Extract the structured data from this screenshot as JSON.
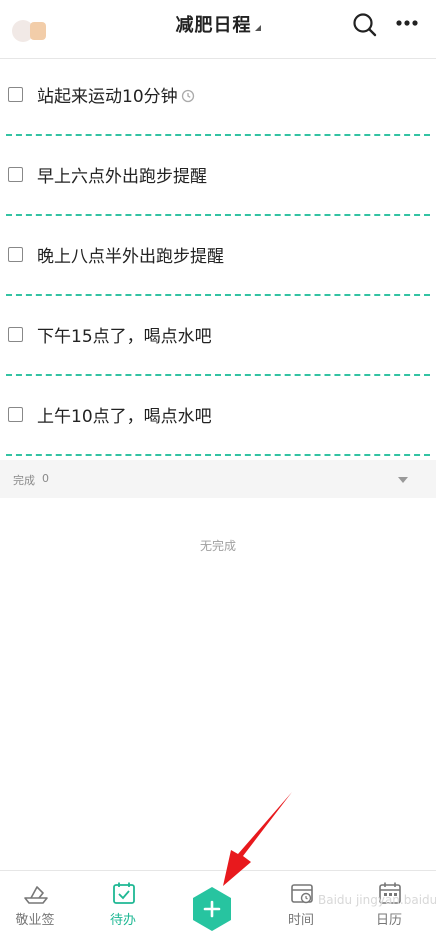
{
  "header": {
    "title": "减肥日程"
  },
  "tasks": [
    {
      "label": "站起来运动10分钟",
      "has_reminder": true
    },
    {
      "label": "早上六点外出跑步提醒",
      "has_reminder": false
    },
    {
      "label": "晚上八点半外出跑步提醒",
      "has_reminder": false
    },
    {
      "label": "下午15点了，喝点水吧",
      "has_reminder": false
    },
    {
      "label": "上午10点了，喝点水吧",
      "has_reminder": false
    }
  ],
  "completed": {
    "label": "完成",
    "count": "0",
    "empty_text": "无完成"
  },
  "bottom_nav": {
    "items": [
      {
        "label": "敬业签",
        "icon": "boat-icon"
      },
      {
        "label": "待办",
        "icon": "calendar-check-icon",
        "active": true
      },
      {
        "label": "时间",
        "icon": "calendar-clock-icon"
      },
      {
        "label": "日历",
        "icon": "calendar-icon"
      }
    ],
    "add_icon": "plus-hexagon-icon"
  },
  "colors": {
    "accent": "#1fb894",
    "divider": "#33c3a3",
    "arrow": "#e8191d"
  },
  "watermark": "Baidu jingyan.baidu"
}
